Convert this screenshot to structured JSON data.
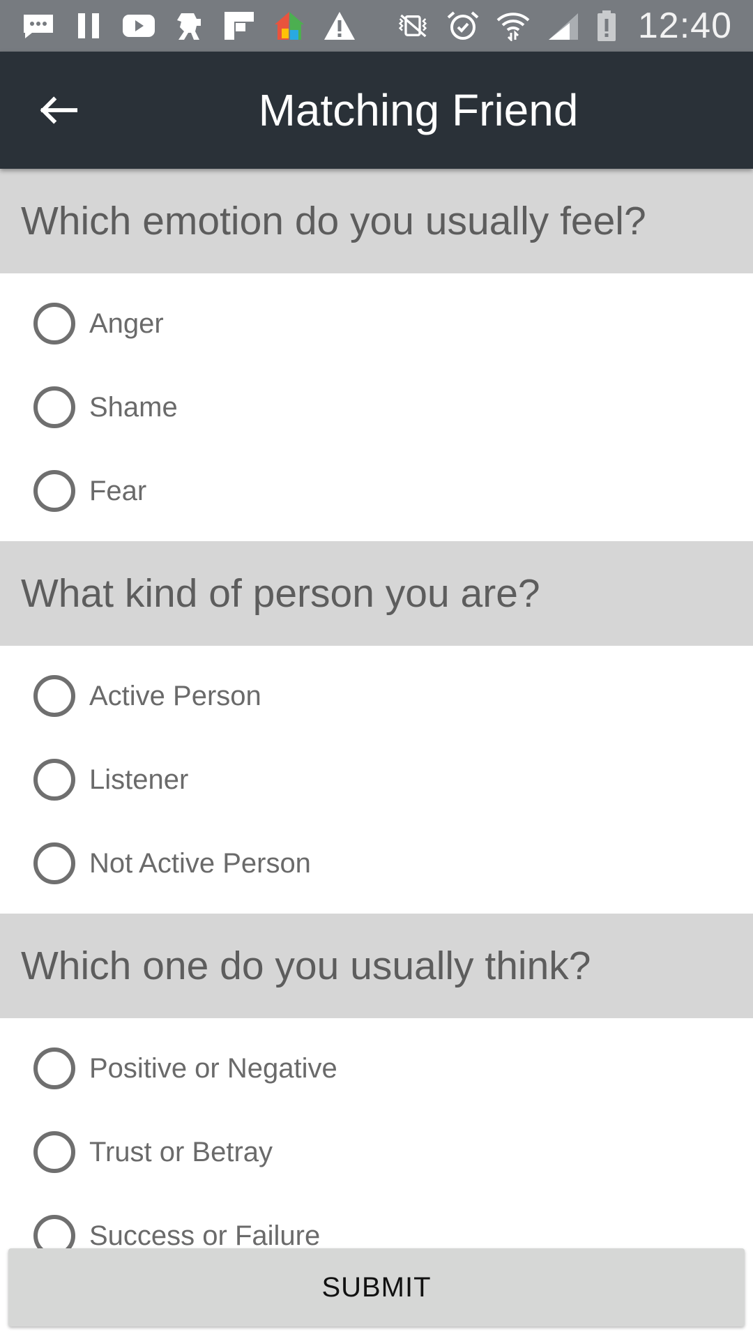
{
  "status_bar": {
    "time": "12:40",
    "icons": [
      "message-icon",
      "pause-icon",
      "youtube-icon",
      "robot-icon",
      "flipboard-icon",
      "home-launcher-icon",
      "warning-icon",
      "vibrate-icon",
      "alarm-icon",
      "wifi-icon",
      "signal-icon",
      "battery-alert-icon"
    ]
  },
  "app_bar": {
    "title": "Matching Friend",
    "back_icon": "arrow-left-icon"
  },
  "questions": [
    {
      "title": "Which emotion do you usually feel?",
      "options": [
        "Anger",
        "Shame",
        "Fear"
      ]
    },
    {
      "title": "What kind of person you are?",
      "options": [
        "Active Person",
        "Listener",
        "Not Active Person"
      ]
    },
    {
      "title": "Which one do you usually think?",
      "options": [
        "Positive or Negative",
        "Trust or Betray",
        "Success or Failure"
      ]
    }
  ],
  "submit_label": "SUBMIT",
  "colors": {
    "status_bar": "#777b80",
    "app_bar": "#2a3138",
    "section_header": "#d6d6d6",
    "radio_border": "#6f6f6f",
    "button": "#d6d7d6"
  }
}
